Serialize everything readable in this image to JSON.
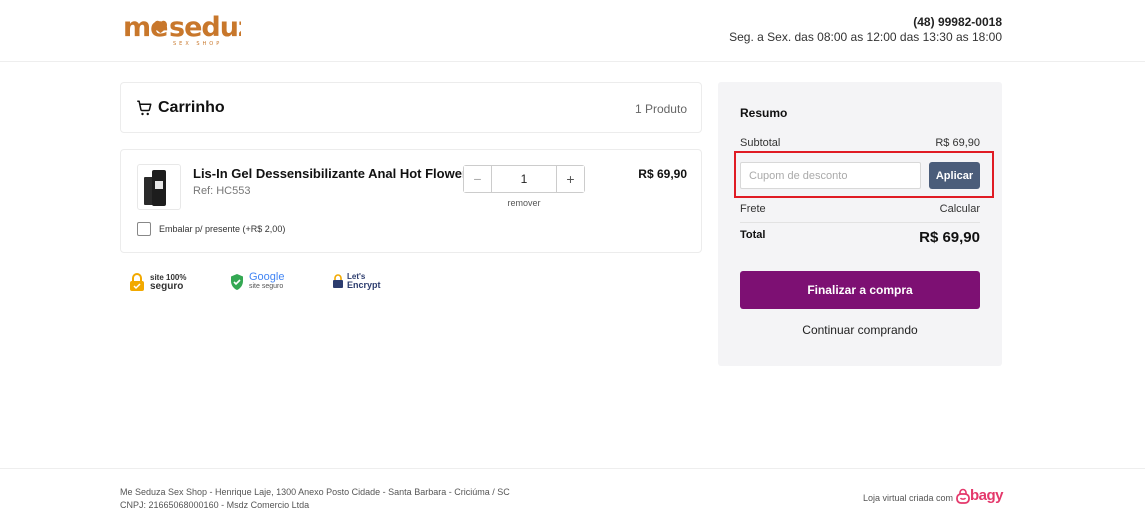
{
  "header": {
    "logo_text": "Me Seduza",
    "logo_tagline": "SEX SHOP",
    "phone": "(48) 99982-0018",
    "hours": "Seg. a Sex. das 08:00 as 12:00 das 13:30 as 18:00"
  },
  "cart": {
    "title": "Carrinho",
    "count": "1 Produto",
    "item": {
      "name": "Lis-In Gel Dessensibilizante Anal Hot Flowers",
      "ref": "Ref: HC553",
      "quantity": "1",
      "remove_label": "remover",
      "price": "R$ 69,90",
      "gift_label": "Embalar p/ presente (+R$ 2,00)"
    }
  },
  "seals": {
    "site_seguro": [
      "site 100%",
      "seguro"
    ],
    "google": [
      "Google",
      "site seguro"
    ],
    "lets_encrypt": [
      "Let's",
      "Encrypt"
    ]
  },
  "summary": {
    "title": "Resumo",
    "subtotal_label": "Subtotal",
    "subtotal_value": "R$ 69,90",
    "coupon_placeholder": "Cupom de desconto",
    "apply_label": "Aplicar",
    "shipping_label": "Frete",
    "shipping_value": "Calcular",
    "total_label": "Total",
    "total_value": "R$ 69,90",
    "checkout_label": "Finalizar a compra",
    "continue_label": "Continuar comprando"
  },
  "footer": {
    "address": "Me Seduza Sex Shop - Henrique Laje, 1300 Anexo Posto Cidade - Santa Barbara - Criciúma / SC",
    "cnpj": "CNPJ: 21665068000160 - Msdz Comercio Ltda",
    "made_with": "Loja virtual criada com",
    "platform": "bagy"
  },
  "colors": {
    "brand": "#c8772b",
    "checkout": "#7d1073",
    "apply": "#4b5d7a",
    "highlight": "#e01b24",
    "bagy": "#e4386b"
  }
}
